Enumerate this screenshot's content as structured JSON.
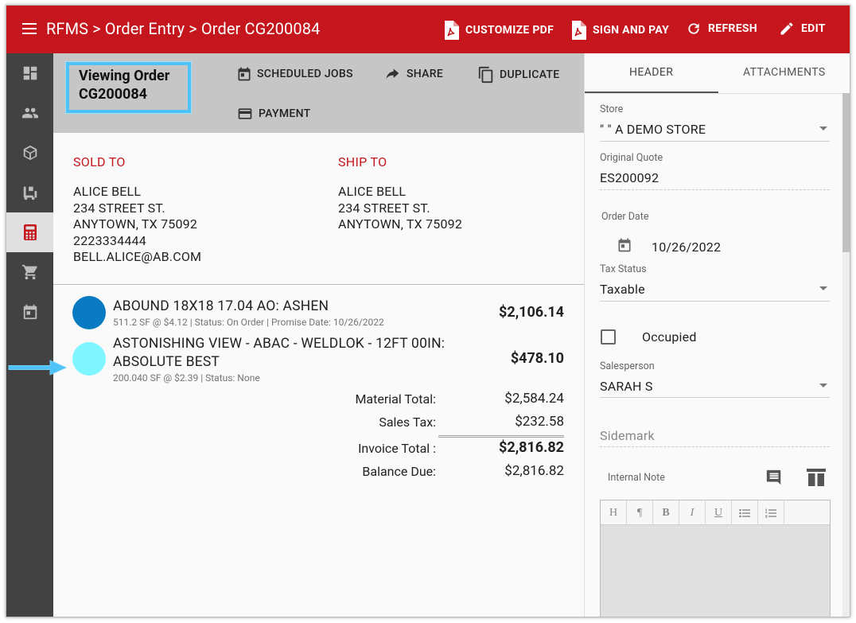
{
  "topbar": {
    "breadcrumb": "RFMS > Order Entry > Order CG200084",
    "actions": [
      {
        "label": "CUSTOMIZE PDF",
        "icon": "pdf-icon"
      },
      {
        "label": "SIGN AND PAY",
        "icon": "sign-pdf-icon"
      },
      {
        "label": "REFRESH",
        "icon": "refresh-icon"
      },
      {
        "label": "EDIT",
        "icon": "pencil-icon"
      }
    ],
    "color": "#c4161c"
  },
  "sidebar": {
    "items": [
      "dashboard-icon",
      "customers-icon",
      "products-icon",
      "inventory-icon",
      "calculator-icon",
      "cart-icon",
      "calendar-icon"
    ],
    "active": "calculator-icon"
  },
  "toolbar": {
    "viewing_line1": "Viewing Order",
    "viewing_line2": "CG200084",
    "scheduled_jobs": "SCHEDULED JOBS",
    "share": "SHARE",
    "duplicate": "DUPLICATE",
    "payment": "PAYMENT"
  },
  "sold_to": {
    "label": "SOLD TO",
    "lines": [
      "ALICE BELL",
      "234 STREET ST.",
      "ANYTOWN, TX 75092",
      "2223334444",
      "BELL.ALICE@AB.COM"
    ]
  },
  "ship_to": {
    "label": "SHIP TO",
    "lines": [
      "ALICE BELL",
      "234 STREET ST.",
      "ANYTOWN, TX 75092"
    ]
  },
  "lines": [
    {
      "title": "ABOUND 18X18 17.04 AO: ASHEN",
      "sub": "511.2 SF @ $4.12  |  Status: On Order  |  Promise Date: 10/26/2022",
      "amount": "$2,106.14",
      "dot_color": "#0a7bc2"
    },
    {
      "title1": "ASTONISHING VIEW - ABAC - WELDLOK - 12FT 00IN:",
      "title2": "ABSOLUTE BEST",
      "sub": "200.040 SF @ $2.39  |  Status: None",
      "amount": "$478.10",
      "dot_color": "#7ff6ff"
    }
  ],
  "totals": {
    "material_label": "Material Total:",
    "material": "$2,584.24",
    "tax_label": "Sales Tax:",
    "tax": "$232.58",
    "invoice_label": "Invoice Total :",
    "invoice": "$2,816.82",
    "balance_label": "Balance Due:",
    "balance": "$2,816.82"
  },
  "panel": {
    "tab_header": "HEADER",
    "tab_attachments": "ATTACHMENTS",
    "store_label": "Store",
    "store": "\" \" A DEMO STORE",
    "quote_label": "Original Quote",
    "quote": "ES200092",
    "order_date_label": "Order Date",
    "order_date": "10/26/2022",
    "tax_status_label": "Tax Status",
    "tax_status": "Taxable",
    "occupied": "Occupied",
    "salesperson_label": "Salesperson",
    "salesperson": "SARAH S",
    "sidemark": "Sidemark",
    "internal_note": "Internal Note",
    "editor_buttons": [
      "H",
      "¶",
      "B",
      "I",
      "U",
      "bulleted-list-icon",
      "numbered-list-icon"
    ]
  },
  "highlight_color": "#4fc3f7"
}
